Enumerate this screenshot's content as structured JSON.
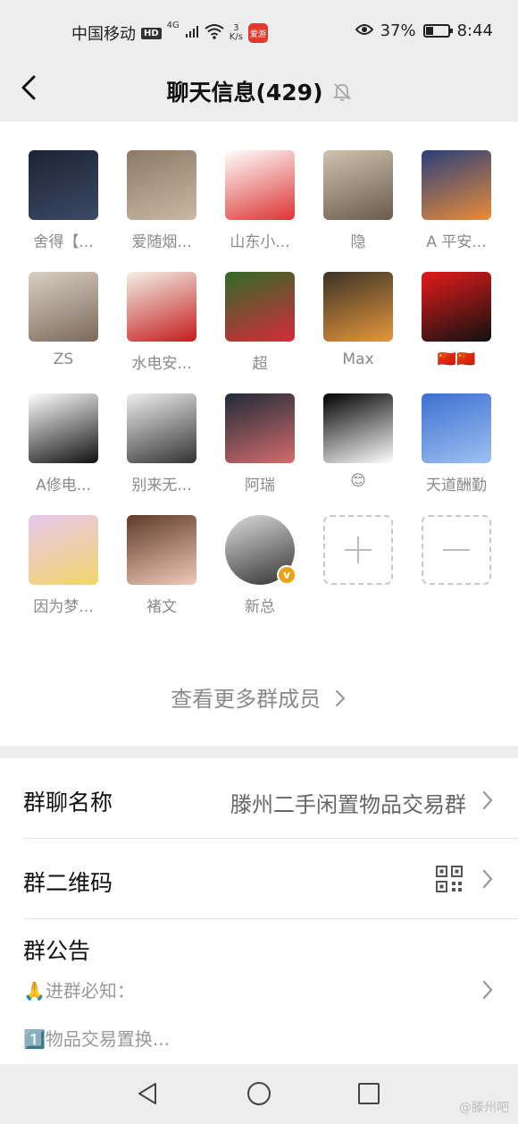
{
  "status_bar": {
    "carrier": "中国移动",
    "hd": "HD",
    "net": "4G",
    "speed_value": "3",
    "speed_unit": "K/s",
    "app_badge": "爱游",
    "battery": "37%",
    "battery_level": 0.37,
    "time": "8:44"
  },
  "header": {
    "title": "聊天信息(429)"
  },
  "members": [
    {
      "name": "舍得【...",
      "icon": "car-avatar",
      "colors": [
        "#1b2433",
        "#3d4a66"
      ]
    },
    {
      "name": "爱随烟...",
      "icon": "cat-avatar",
      "colors": [
        "#8c7a68",
        "#c9b9a4"
      ]
    },
    {
      "name": "山东小...",
      "icon": "calligraphy-avatar",
      "colors": [
        "#ffffff",
        "#d33"
      ]
    },
    {
      "name": "隐",
      "icon": "person-avatar",
      "colors": [
        "#cfc3b0",
        "#6a5b4a"
      ]
    },
    {
      "name": "A 平安...",
      "icon": "sunset-avatar",
      "colors": [
        "#2b3f7a",
        "#e88b3a"
      ]
    },
    {
      "name": "ZS",
      "icon": "girl-avatar",
      "colors": [
        "#d9cfc4",
        "#7b6a5c"
      ]
    },
    {
      "name": "水电安...",
      "icon": "flag-avatar",
      "colors": [
        "#f4f0e8",
        "#c31c1c"
      ]
    },
    {
      "name": "超",
      "icon": "flower-avatar",
      "colors": [
        "#2f6b2a",
        "#d62a3a"
      ]
    },
    {
      "name": "Max",
      "icon": "silhouette-avatar",
      "colors": [
        "#3b3328",
        "#e6963b"
      ]
    },
    {
      "name": "🇨🇳🇨🇳",
      "icon": "red-calligraphy-avatar",
      "colors": [
        "#e31b1b",
        "#111111"
      ]
    },
    {
      "name": "A修电...",
      "icon": "printer-cartoon-avatar",
      "colors": [
        "#ffffff",
        "#111111"
      ]
    },
    {
      "name": "别来无...",
      "icon": "cartoon-boy-avatar",
      "colors": [
        "#efefef",
        "#333333"
      ]
    },
    {
      "name": "阿瑞",
      "icon": "night-scene-avatar",
      "colors": [
        "#1f2a38",
        "#d46c6c"
      ]
    },
    {
      "name": "😊",
      "icon": "hands-avatar",
      "colors": [
        "#000000",
        "#ffffff"
      ]
    },
    {
      "name": "天道酬勤",
      "icon": "dunes-avatar",
      "colors": [
        "#3d6fd1",
        "#9ec1f0"
      ]
    },
    {
      "name": "因为梦...",
      "icon": "anime-avatar",
      "colors": [
        "#e6c7ec",
        "#f2d66b"
      ]
    },
    {
      "name": "褚文",
      "icon": "girl-selfie-avatar",
      "colors": [
        "#5f3a2a",
        "#f1c9b6"
      ]
    },
    {
      "name": "新总",
      "icon": "couple-avatar",
      "colors": [
        "#dcdcdc",
        "#333333"
      ],
      "round": true,
      "verified": true
    }
  ],
  "more_members": "查看更多群成员",
  "settings": {
    "group_name_label": "群聊名称",
    "group_name_value": "滕州二手闲置物品交易群",
    "qr_label": "群二维码",
    "notice_label": "群公告",
    "notice_line1": "🙏进群必知：",
    "notice_line2": "1️⃣物品交易置换..."
  },
  "watermark": "@滕州吧"
}
